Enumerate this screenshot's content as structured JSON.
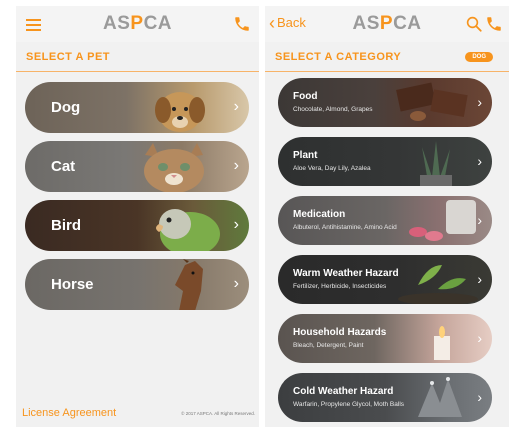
{
  "left_screen": {
    "logo": {
      "part1": "AS",
      "part2": "P",
      "part3": "CA"
    },
    "section_title": "SELECT A PET",
    "pets": [
      {
        "label": "Dog"
      },
      {
        "label": "Cat"
      },
      {
        "label": "Bird"
      },
      {
        "label": "Horse"
      }
    ],
    "footer": {
      "license": "License Agreement",
      "copyright": "© 2017 ASPCA. All Rights Reserved."
    }
  },
  "right_screen": {
    "back_label": "Back",
    "logo": {
      "part1": "AS",
      "part2": "P",
      "part3": "CA"
    },
    "section_title": "SELECT A CATEGORY",
    "badge": "DOG",
    "categories": [
      {
        "label": "Food",
        "sub": "Chocolate, Almond, Grapes"
      },
      {
        "label": "Plant",
        "sub": "Aloe Vera, Day Lily, Azalea"
      },
      {
        "label": "Medication",
        "sub": "Albuterol, Antihistamine, Amino Acid"
      },
      {
        "label": "Warm Weather Hazard",
        "sub": "Fertilizer, Herbicide, Insecticides"
      },
      {
        "label": "Household Hazards",
        "sub": "Bleach, Detergent, Paint"
      },
      {
        "label": "Cold Weather Hazard",
        "sub": "Warfarin, Propylene Glycol, Moth Balls"
      }
    ]
  },
  "colors": {
    "accent": "#f7941d",
    "logo_gray": "#9a9a9a"
  },
  "icons": [
    "hamburger-icon",
    "phone-icon",
    "back-chevron-icon",
    "search-icon",
    "chevron-right-icon"
  ]
}
